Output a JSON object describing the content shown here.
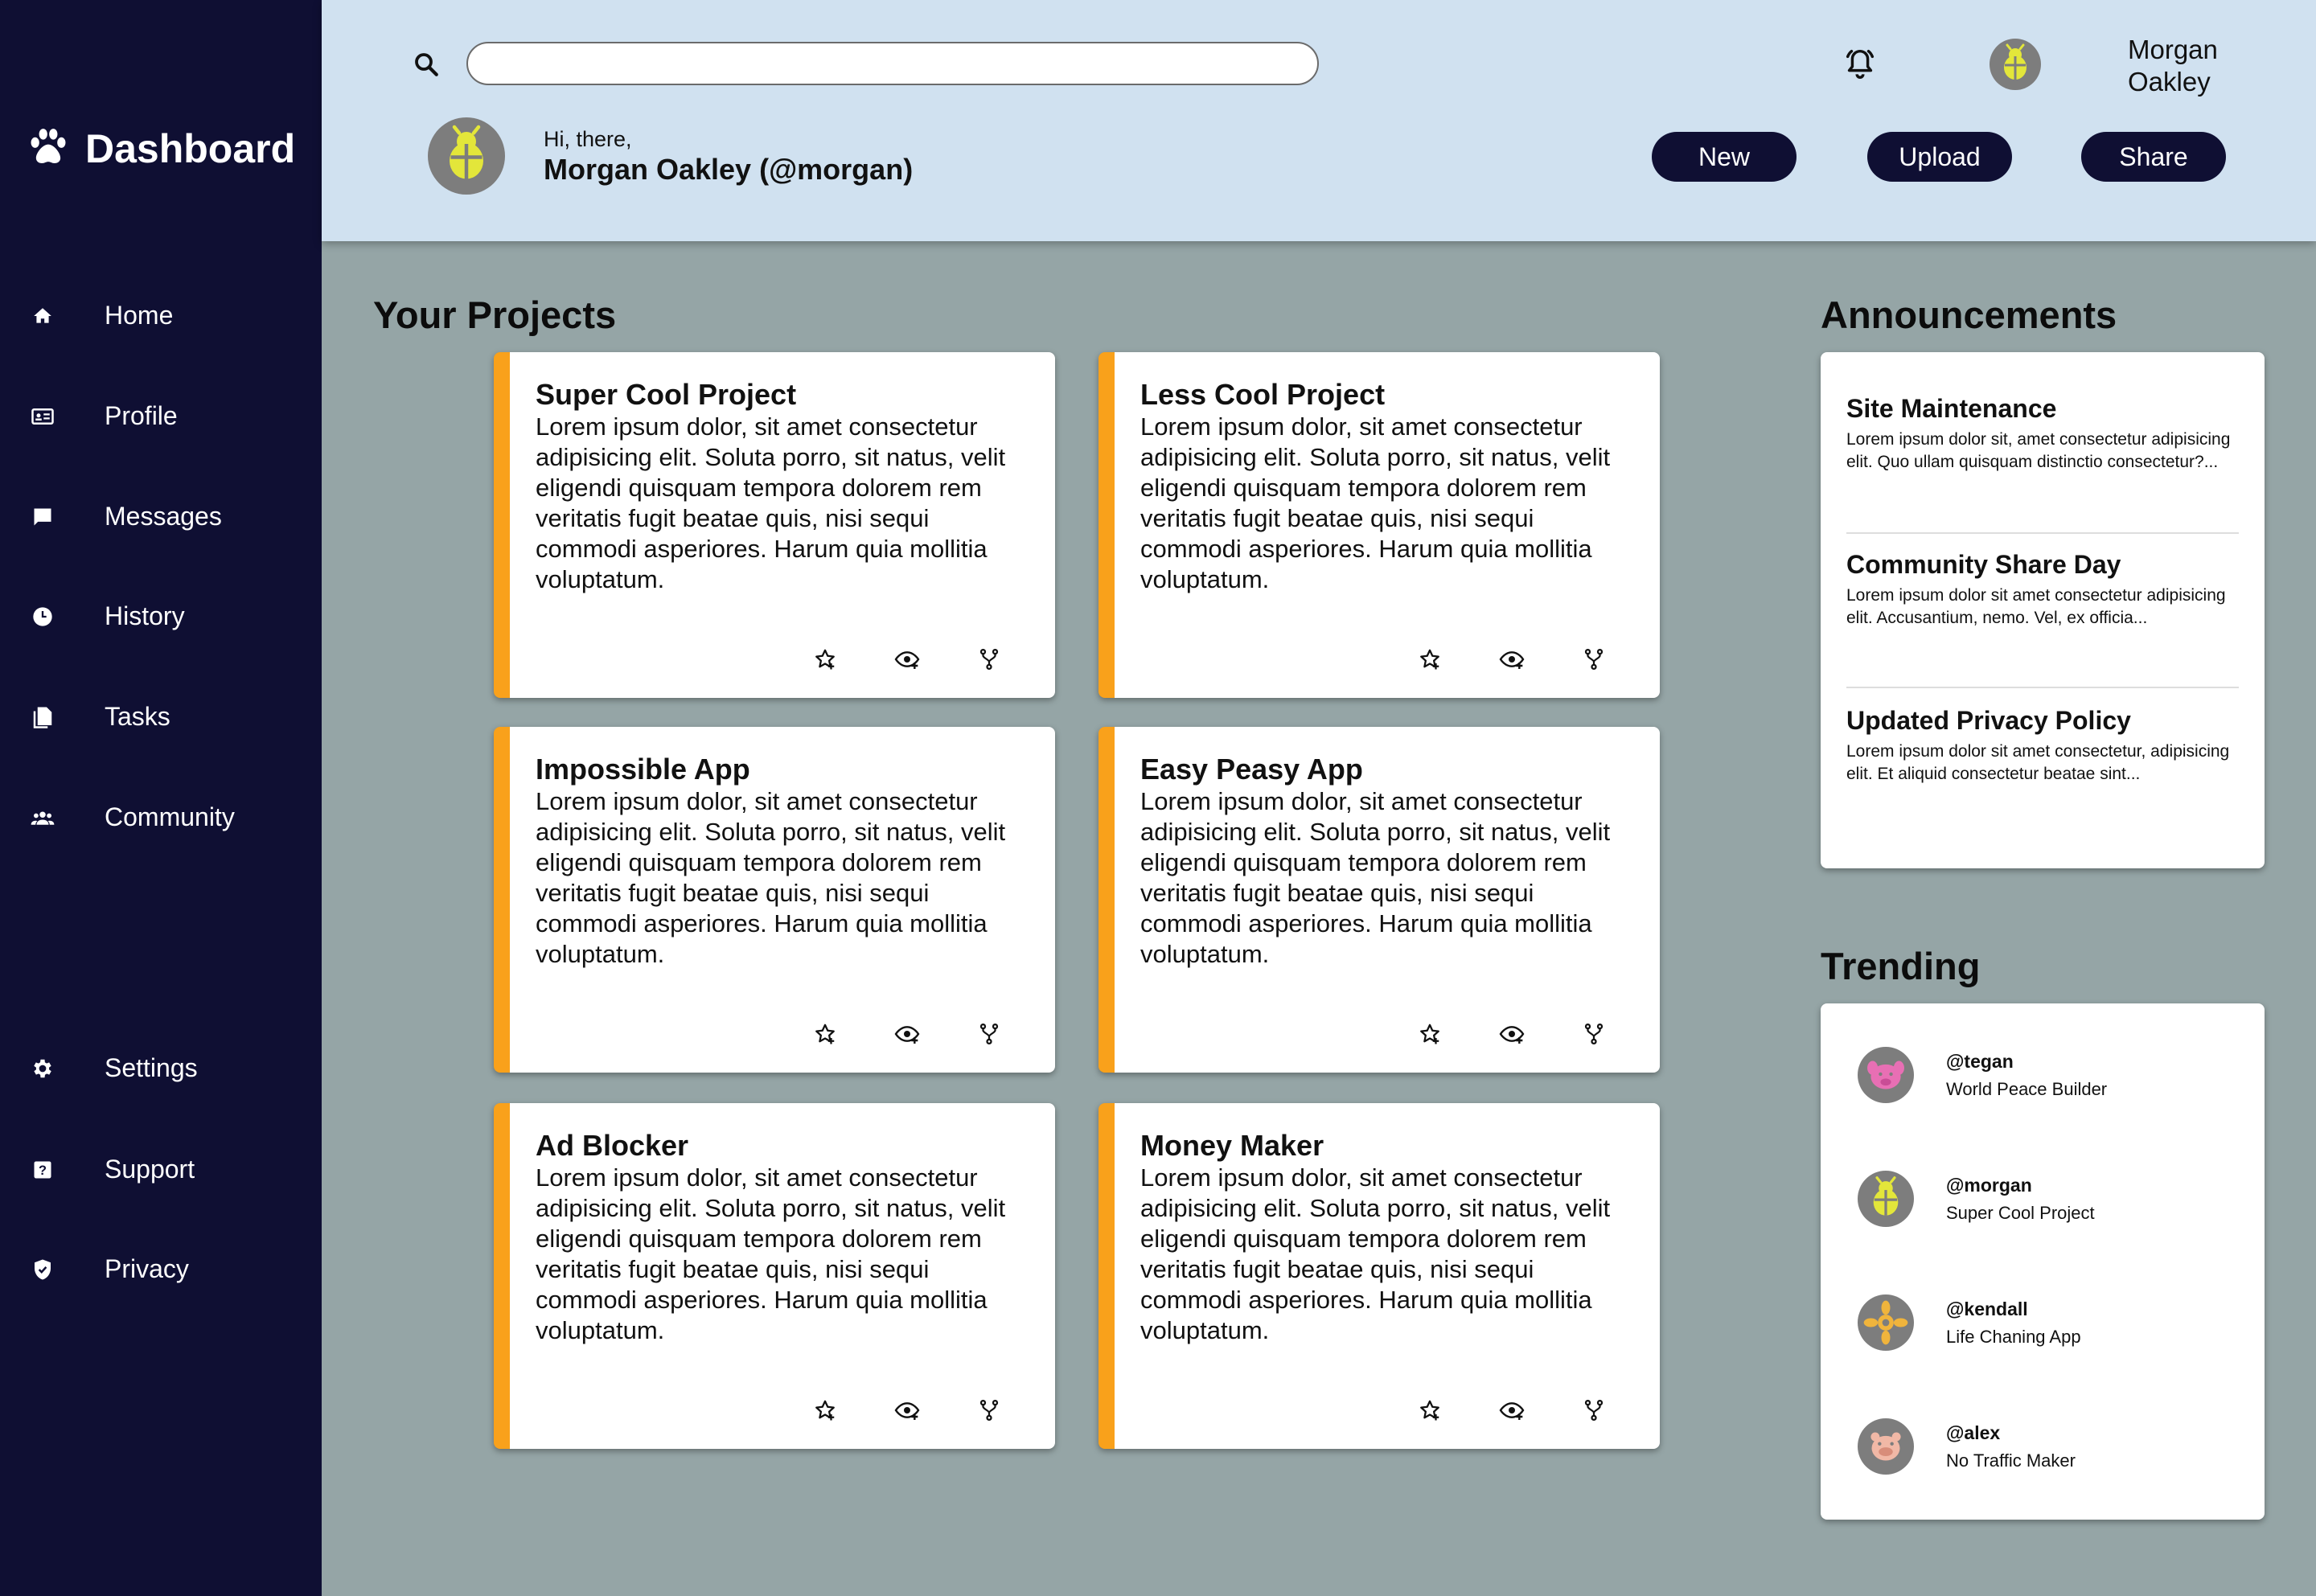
{
  "sidebar": {
    "brand": {
      "label": "Dashboard",
      "icon": "paw-icon"
    },
    "items": [
      {
        "label": "Home",
        "icon": "home-icon"
      },
      {
        "label": "Profile",
        "icon": "id-card-icon"
      },
      {
        "label": "Messages",
        "icon": "message-icon"
      },
      {
        "label": "History",
        "icon": "clock-icon"
      },
      {
        "label": "Tasks",
        "icon": "documents-icon"
      },
      {
        "label": "Community",
        "icon": "people-icon"
      },
      {
        "label": "Settings",
        "icon": "gear-icon"
      },
      {
        "label": "Support",
        "icon": "help-icon"
      },
      {
        "label": "Privacy",
        "icon": "shield-icon"
      }
    ]
  },
  "header": {
    "search": {
      "placeholder": "",
      "value": ""
    },
    "user_name": "Morgan Oakley",
    "greeting": "Hi, there,",
    "greeting_name": "Morgan Oakley (@morgan)",
    "buttons": {
      "new": "New",
      "upload": "Upload",
      "share": "Share"
    }
  },
  "projects": {
    "title": "Your Projects",
    "items": [
      {
        "title": "Super Cool Project",
        "body": "Lorem ipsum dolor, sit amet consectetur adipisicing elit. Soluta porro, sit natus, velit eligendi quisquam tempora dolorem rem veritatis fugit beatae quis, nisi sequi commodi asperiores. Harum quia mollitia voluptatum."
      },
      {
        "title": "Less Cool Project",
        "body": "Lorem ipsum dolor, sit amet consectetur adipisicing elit. Soluta porro, sit natus, velit eligendi quisquam tempora dolorem rem veritatis fugit beatae quis, nisi sequi commodi asperiores. Harum quia mollitia voluptatum."
      },
      {
        "title": "Impossible App",
        "body": "Lorem ipsum dolor, sit amet consectetur adipisicing elit. Soluta porro, sit natus, velit eligendi quisquam tempora dolorem rem veritatis fugit beatae quis, nisi sequi commodi asperiores. Harum quia mollitia voluptatum."
      },
      {
        "title": "Easy Peasy App",
        "body": "Lorem ipsum dolor, sit amet consectetur adipisicing elit. Soluta porro, sit natus, velit eligendi quisquam tempora dolorem rem veritatis fugit beatae quis, nisi sequi commodi asperiores. Harum quia mollitia voluptatum."
      },
      {
        "title": "Ad Blocker",
        "body": "Lorem ipsum dolor, sit amet consectetur adipisicing elit. Soluta porro, sit natus, velit eligendi quisquam tempora dolorem rem veritatis fugit beatae quis, nisi sequi commodi asperiores. Harum quia mollitia voluptatum."
      },
      {
        "title": "Money Maker",
        "body": "Lorem ipsum dolor, sit amet consectetur adipisicing elit. Soluta porro, sit natus, velit eligendi quisquam tempora dolorem rem veritatis fugit beatae quis, nisi sequi commodi asperiores. Harum quia mollitia voluptatum."
      }
    ]
  },
  "announcements": {
    "title": "Announcements",
    "items": [
      {
        "title": "Site Maintenance",
        "text": "Lorem ipsum dolor sit, amet consectetur adipisicing elit. Quo ullam quisquam distinctio consectetur?..."
      },
      {
        "title": "Community Share Day",
        "text": "Lorem ipsum dolor sit amet consectetur adipisicing elit. Accusantium, nemo. Vel, ex officia..."
      },
      {
        "title": "Updated Privacy Policy",
        "text": "Lorem ipsum dolor sit amet consectetur, adipisicing elit. Et aliquid consectetur beatae sint..."
      }
    ]
  },
  "trending": {
    "title": "Trending",
    "items": [
      {
        "handle": "@tegan",
        "project": "World Peace Builder"
      },
      {
        "handle": "@morgan",
        "project": "Super Cool Project"
      },
      {
        "handle": "@kendall",
        "project": "Life Chaning App"
      },
      {
        "handle": "@alex",
        "project": "No Traffic Maker"
      }
    ]
  },
  "colors": {
    "sidebar_bg": "#0f0f33",
    "header_bg": "#d0e1f0",
    "page_bg": "#95a5a6",
    "accent": "#f9a11b"
  }
}
